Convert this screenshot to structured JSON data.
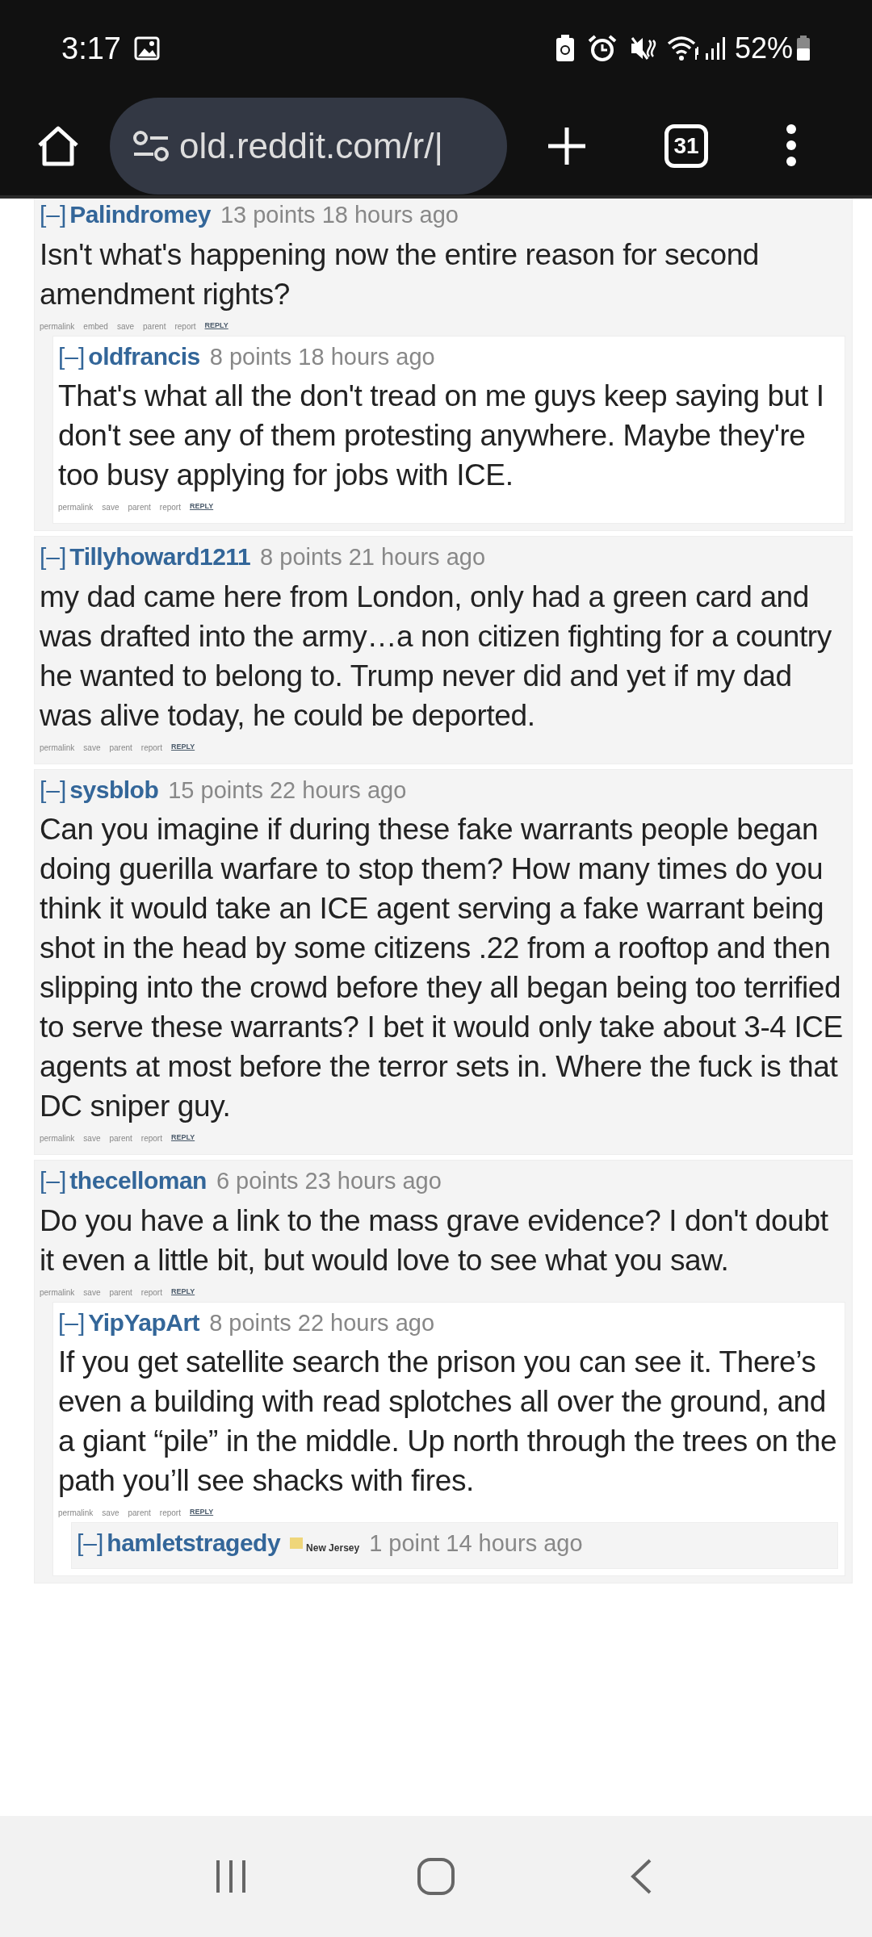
{
  "status_bar": {
    "time": "3:17",
    "battery": "52%"
  },
  "browser": {
    "url": "old.reddit.com/r/|",
    "tab_count": "31"
  },
  "comments": [
    {
      "toggle": "[–]",
      "user": "Palindromey",
      "meta": "13 points 18 hours ago",
      "body": "Isn't what's happening now the entire reason for second amendment rights?",
      "actions": [
        {
          "kind": "link",
          "label": "permalink"
        },
        {
          "kind": "link",
          "label": "embed"
        },
        {
          "kind": "link",
          "label": "save"
        },
        {
          "kind": "link",
          "label": "parent"
        },
        {
          "kind": "link",
          "label": "report"
        },
        {
          "kind": "reply",
          "label": "REPLY"
        }
      ],
      "children": [
        {
          "toggle": "[–]",
          "user": "oldfrancis",
          "meta": "8 points 18 hours ago",
          "body": "That's what all the don't tread on me guys keep saying but I don't see any of them protesting anywhere. Maybe they're too busy applying for jobs with ICE.",
          "actions": [
            {
              "kind": "link",
              "label": "permalink"
            },
            {
              "kind": "link",
              "label": "save"
            },
            {
              "kind": "link",
              "label": "parent"
            },
            {
              "kind": "link",
              "label": "report"
            },
            {
              "kind": "reply",
              "label": "REPLY"
            }
          ]
        }
      ]
    },
    {
      "toggle": "[–]",
      "user": "Tillyhoward1211",
      "meta": "8 points 21 hours ago",
      "body": "my dad came here from London, only had a green card and was drafted into the army…a non citizen fighting for a country he wanted to belong to. Trump never did and yet if my dad was alive today, he could be deported.",
      "actions": [
        {
          "kind": "link",
          "label": "permalink"
        },
        {
          "kind": "link",
          "label": "save"
        },
        {
          "kind": "link",
          "label": "parent"
        },
        {
          "kind": "link",
          "label": "report"
        },
        {
          "kind": "reply",
          "label": "REPLY"
        }
      ]
    },
    {
      "toggle": "[–]",
      "user": "sysblob",
      "meta": "15 points 22 hours ago",
      "body": "Can you imagine if during these fake warrants people began doing guerilla warfare to stop them? How many times do you think it would take an ICE agent serving a fake warrant being shot in the head by some citizens .22 from a rooftop and then slipping into the crowd before they all began being too terrified to serve these warrants? I bet it would only take about 3-4 ICE agents at most before the terror sets in. Where the fuck is that DC sniper guy.",
      "actions": [
        {
          "kind": "link",
          "label": "permalink"
        },
        {
          "kind": "link",
          "label": "save"
        },
        {
          "kind": "link",
          "label": "parent"
        },
        {
          "kind": "link",
          "label": "report"
        },
        {
          "kind": "reply",
          "label": "REPLY"
        }
      ]
    },
    {
      "toggle": "[–]",
      "user": "thecelloman",
      "meta": "6 points 23 hours ago",
      "body": "Do you have a link to the mass grave evidence? I don't doubt it even a little bit, but would love to see what you saw.",
      "actions": [
        {
          "kind": "link",
          "label": "permalink"
        },
        {
          "kind": "link",
          "label": "save"
        },
        {
          "kind": "link",
          "label": "parent"
        },
        {
          "kind": "link",
          "label": "report"
        },
        {
          "kind": "reply",
          "label": "REPLY"
        }
      ],
      "children": [
        {
          "toggle": "[–]",
          "user": "YipYapArt",
          "meta": "8 points 22 hours ago",
          "body": "If you get satellite search the prison you can see it. There’s even a building with read splotches all over the ground, and a giant “pile” in the middle. Up north through the trees on the path you’ll see shacks with fires.",
          "actions": [
            {
              "kind": "link",
              "label": "permalink"
            },
            {
              "kind": "link",
              "label": "save"
            },
            {
              "kind": "link",
              "label": "parent"
            },
            {
              "kind": "link",
              "label": "report"
            },
            {
              "kind": "reply",
              "label": "REPLY"
            }
          ],
          "children": [
            {
              "toggle": "[–]",
              "user": "hamletstragedy",
              "flair": "New Jersey",
              "meta": "1 point 14 hours ago"
            }
          ]
        }
      ]
    }
  ]
}
